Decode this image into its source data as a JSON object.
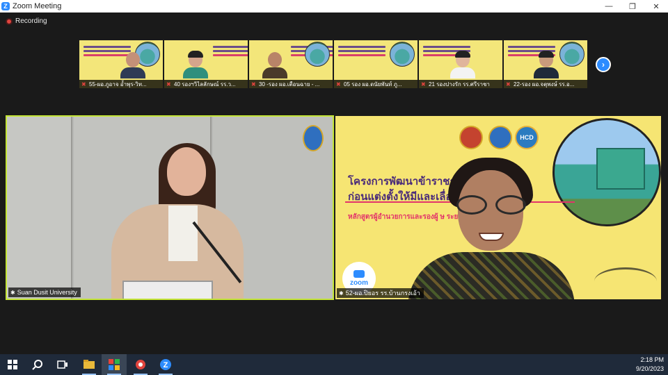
{
  "window": {
    "title": "Zoom Meeting",
    "minimize_glyph": "—",
    "restore_glyph": "❐",
    "close_glyph": "✕"
  },
  "recording": {
    "label": "Recording"
  },
  "thumbnails": [
    {
      "name": "55-ผอ.ภูอาจ อ้ำพุร-วิท..."
    },
    {
      "name": "40 รองฯวิไลลักษณ์ รร.ว..."
    },
    {
      "name": "30 -รอง ผอ.เตือนฉาย - ..."
    },
    {
      "name": "05 รอง ผอ.ดนัยพันท์ ภู..."
    },
    {
      "name": "21 รองปางรัก รร.ศรีราชา"
    },
    {
      "name": "22-รอง ผอ.จตุพงษ์ รร.อ..."
    }
  ],
  "main_tiles": {
    "left": {
      "name": "Suan Dusit University"
    },
    "right": {
      "name": "52-ผอ.ปิยอร รร.บ้านกรงเอ้า",
      "slide_title_line1": "โครงการพัฒนาข้าราชก                        รทางการศึกษา",
      "slide_title_line2": "ก่อนแต่งตั้งให้มีและเลื่อ",
      "slide_subtitle": "หลักสูตรผู้อำนวยการและรองผู้                    ษ ระยะที่ 133",
      "logo_text": "HCD",
      "zoom_badge": "zoom"
    }
  },
  "taskbar": {
    "time": "2:18 PM",
    "date": "9/20/2023"
  },
  "colors": {
    "active_speaker_border": "#c4e536",
    "zoom_blue": "#2d8cff",
    "slide_background": "#f6e573",
    "slide_title": "#4a2b7a",
    "slide_subtitle": "#e2336a",
    "recording_dot": "#e0443e"
  }
}
